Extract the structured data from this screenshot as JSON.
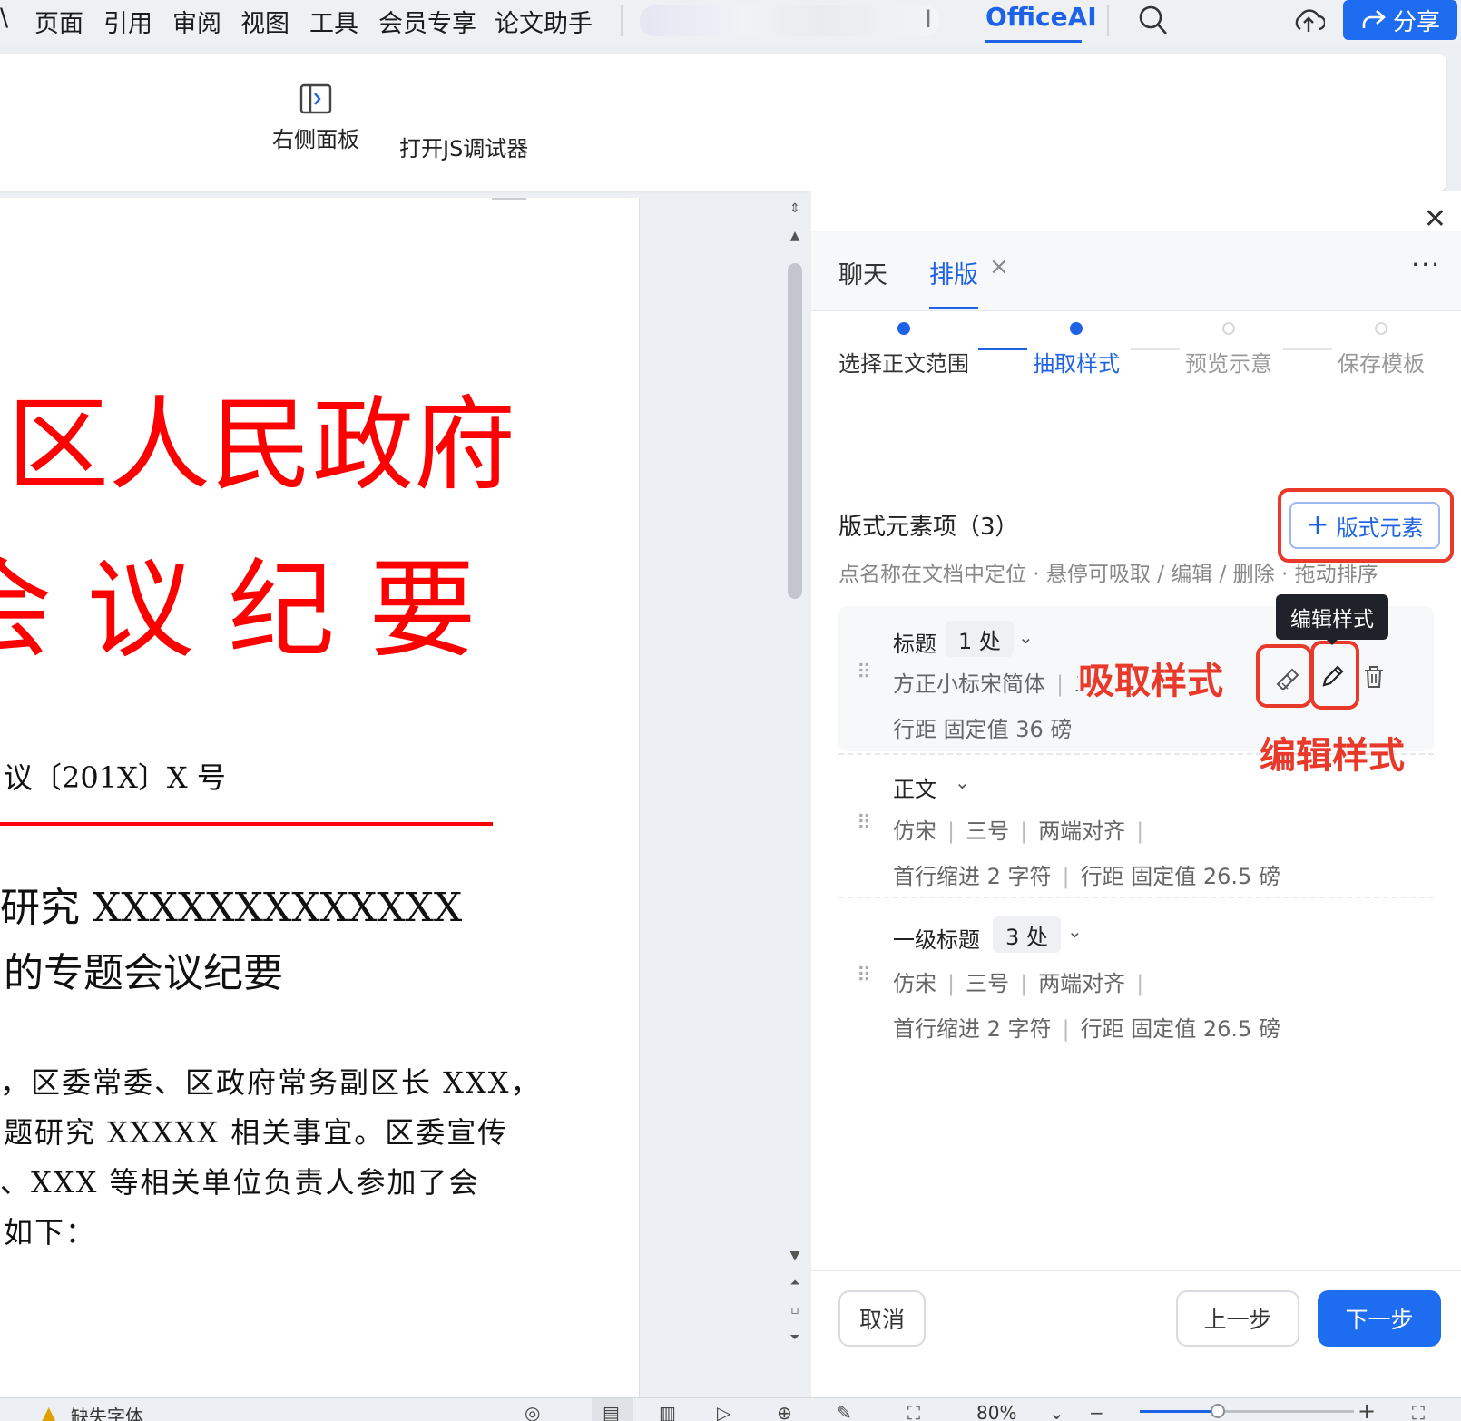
{
  "menubar": {
    "items": [
      "\\",
      "页面",
      "引用",
      "审阅",
      "视图",
      "工具",
      "会员专享",
      "论文助手"
    ],
    "blurred_tail": "I",
    "officeai": "OfficeAI",
    "share_label": "分享"
  },
  "ribbon": {
    "right_panel_label": "右侧面板",
    "js_debugger_label": "打开JS调试器"
  },
  "document": {
    "title_line1": "区人民政府",
    "title_line2": "会 议 纪 要",
    "doc_number": "议〔201X〕X 号",
    "subject_line1": "研究 XXXXXXXXXXXXX",
    "subject_line2": "的专题会议纪要",
    "body_lines": [
      "，区委常委、区政府常务副区长 XXX，",
      "题研究 XXXXX 相关事宜。区委宣传",
      "、XXX 等相关单位负责人参加了会",
      "如下："
    ]
  },
  "panel": {
    "tabs": [
      {
        "label": "聊天",
        "active": false
      },
      {
        "label": "排版",
        "active": true
      }
    ],
    "tab_close": "×",
    "more": "···",
    "steps": [
      {
        "label": "选择正文范围",
        "state": "done"
      },
      {
        "label": "抽取样式",
        "state": "current"
      },
      {
        "label": "预览示意",
        "state": "todo"
      },
      {
        "label": "保存模板",
        "state": "todo"
      }
    ],
    "section_title": "版式元素项（3）",
    "section_hint": "点名称在文档中定位 · 悬停可吸取 / 编辑 / 删除 · 拖动排序",
    "add_button": "版式元素",
    "items": [
      {
        "name": "标题",
        "count": "1 处",
        "detail1": [
          "方正小标宋简体",
          "二"
        ],
        "detail2": "行距 固定值 36 磅"
      },
      {
        "name": "正文",
        "count": "",
        "detail1": [
          "仿宋",
          "三号",
          "两端对齐"
        ],
        "detail2_parts": [
          "首行缩进 2 字符",
          "行距 固定值 26.5 磅"
        ]
      },
      {
        "name": "一级标题",
        "count": "3 处",
        "detail1": [
          "仿宋",
          "三号",
          "两端对齐"
        ],
        "detail2_parts": [
          "首行缩进 2 字符",
          "行距 固定值 26.5 磅"
        ]
      }
    ],
    "tooltip": "编辑样式",
    "annot_absorb": "吸取样式",
    "annot_edit": "编辑样式",
    "buttons": {
      "cancel": "取消",
      "prev": "上一步",
      "next": "下一步"
    }
  },
  "statusbar": {
    "missing_font": "缺失字体",
    "zoom": "80%"
  },
  "colors": {
    "accent": "#1e62e6",
    "doc_red": "#ff0000",
    "annotation_red": "#e8392a"
  }
}
